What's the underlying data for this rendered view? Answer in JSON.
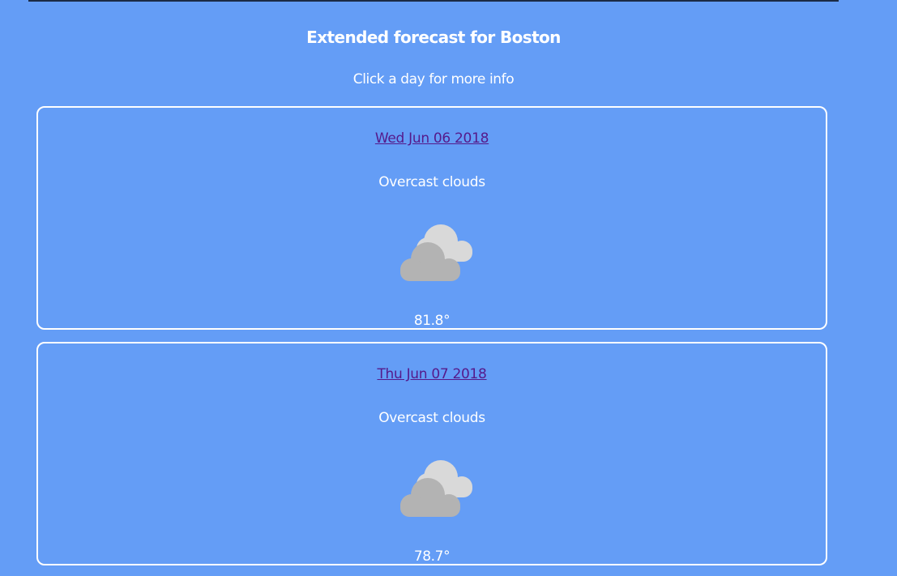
{
  "header": {
    "title": "Extended forecast for Boston",
    "subtitle": "Click a day for more info"
  },
  "days": [
    {
      "date": "Wed Jun 06 2018",
      "description": "Overcast clouds",
      "icon": "overcast-clouds-icon",
      "temperature": "81.8°"
    },
    {
      "date": "Thu Jun 07 2018",
      "description": "Overcast clouds",
      "icon": "overcast-clouds-icon",
      "temperature": "78.7°"
    }
  ],
  "colors": {
    "background": "#649df6",
    "text": "#ffffff",
    "link": "#551a8b",
    "cloud_front": "#b3b3b3",
    "cloud_back": "#d9d9d9"
  }
}
